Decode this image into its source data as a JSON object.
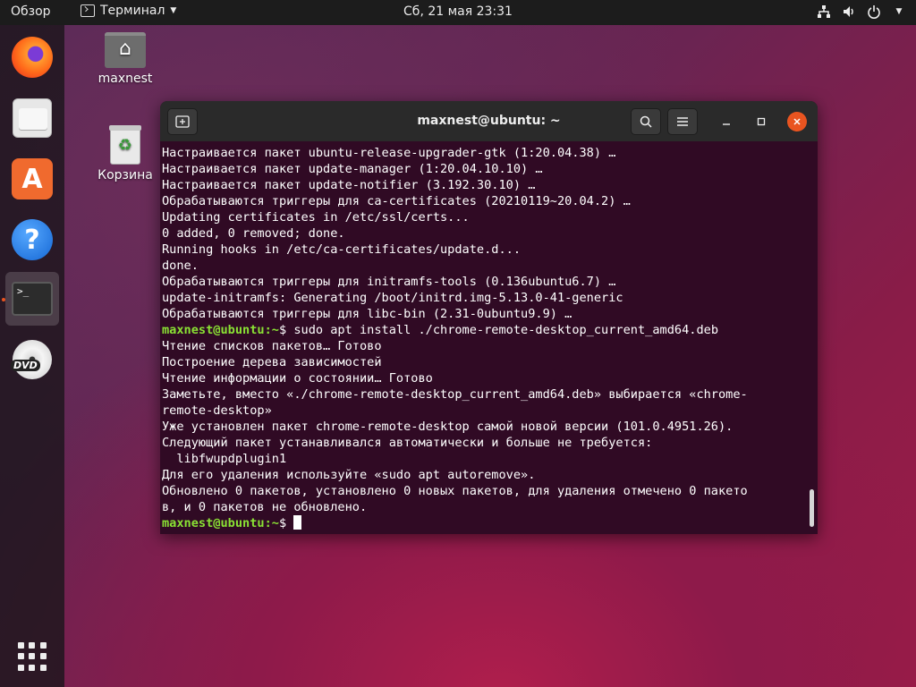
{
  "topbar": {
    "activities": "Обзор",
    "app_menu": "Терминал",
    "clock": "Сб, 21 мая  23:31"
  },
  "desktop": {
    "home_label": "maxnest",
    "trash_label": "Корзина"
  },
  "dock": {
    "items": [
      "firefox",
      "files",
      "software",
      "help",
      "terminal",
      "dvd"
    ]
  },
  "terminal": {
    "title": "maxnest@ubuntu: ~",
    "lines": [
      {
        "text": "Настраивается пакет ubuntu-release-upgrader-gtk (1:20.04.38) …"
      },
      {
        "text": "Настраивается пакет update-manager (1:20.04.10.10) …"
      },
      {
        "text": "Настраивается пакет update-notifier (3.192.30.10) …"
      },
      {
        "text": "Обрабатываются триггеры для ca-certificates (20210119~20.04.2) …"
      },
      {
        "text": "Updating certificates in /etc/ssl/certs..."
      },
      {
        "text": "0 added, 0 removed; done."
      },
      {
        "text": "Running hooks in /etc/ca-certificates/update.d..."
      },
      {
        "text": "done."
      },
      {
        "text": "Обрабатываются триггеры для initramfs-tools (0.136ubuntu6.7) …"
      },
      {
        "text": "update-initramfs: Generating /boot/initrd.img-5.13.0-41-generic"
      },
      {
        "text": "Обрабатываются триггеры для libc-bin (2.31-0ubuntu9.9) …"
      },
      {
        "prompt": "maxnest@ubuntu:~",
        "text": "$ sudo apt install ./chrome-remote-desktop_current_amd64.deb"
      },
      {
        "text": "Чтение списков пакетов… Готово"
      },
      {
        "text": "Построение дерева зависимостей"
      },
      {
        "text": "Чтение информации о состоянии… Готово"
      },
      {
        "text": "Заметьте, вместо «./chrome-remote-desktop_current_amd64.deb» выбирается «chrome-"
      },
      {
        "text": "remote-desktop»"
      },
      {
        "text": "Уже установлен пакет chrome-remote-desktop самой новой версии (101.0.4951.26)."
      },
      {
        "text": "Следующий пакет устанавливался автоматически и больше не требуется:"
      },
      {
        "text": "  libfwupdplugin1"
      },
      {
        "text": "Для его удаления используйте «sudo apt autoremove»."
      },
      {
        "text": "Обновлено 0 пакетов, установлено 0 новых пакетов, для удаления отмечено 0 пакето"
      },
      {
        "text": "в, и 0 пакетов не обновлено."
      },
      {
        "prompt": "maxnest@ubuntu:~",
        "text": "$ ",
        "cursor": true
      }
    ]
  },
  "colors": {
    "terminal_bg": "#300a24",
    "prompt": "#8ae234",
    "accent": "#e95420"
  }
}
